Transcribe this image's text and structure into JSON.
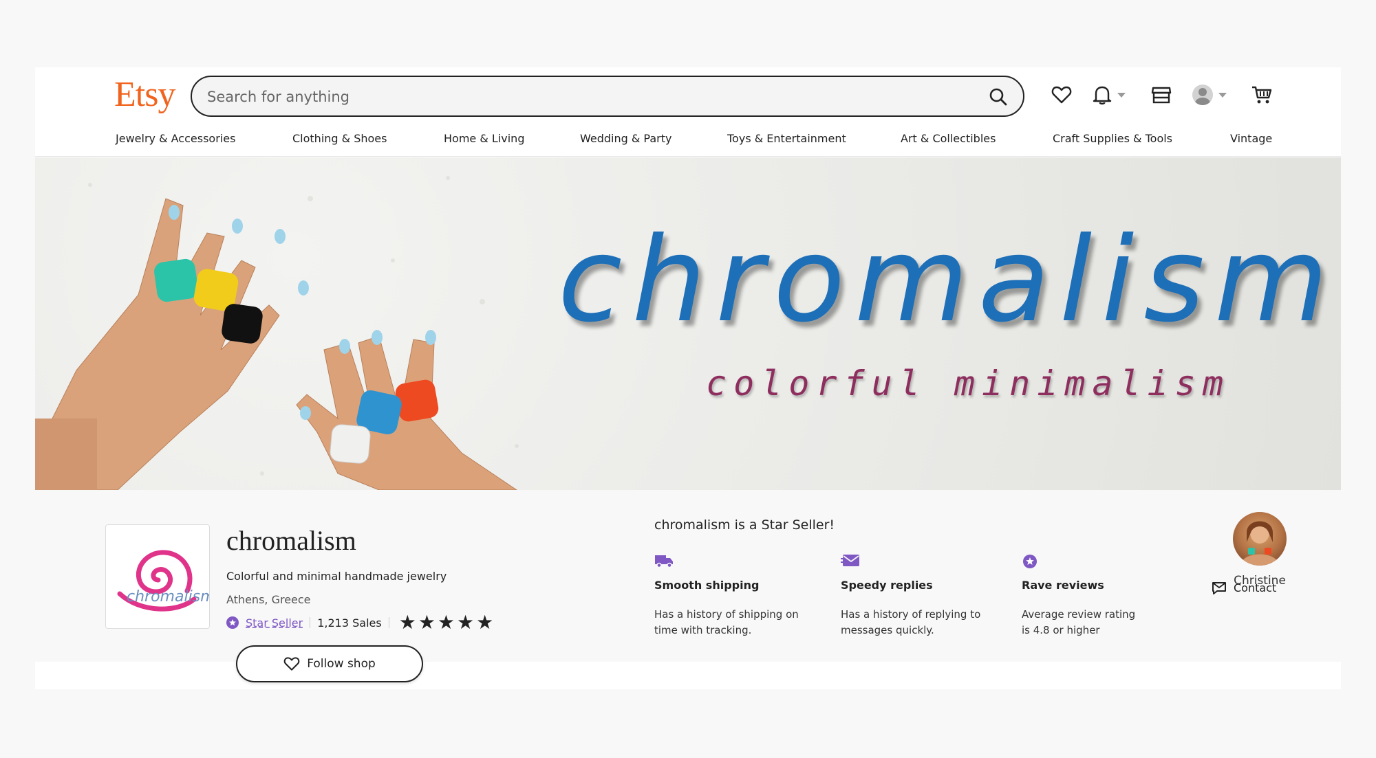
{
  "header": {
    "logo": "Etsy",
    "search_placeholder": "Search for anything"
  },
  "nav": {
    "items": [
      {
        "label": "Jewelry & Accessories"
      },
      {
        "label": "Clothing & Shoes"
      },
      {
        "label": "Home & Living"
      },
      {
        "label": "Wedding & Party"
      },
      {
        "label": "Toys & Entertainment"
      },
      {
        "label": "Art & Collectibles"
      },
      {
        "label": "Craft Supplies & Tools"
      },
      {
        "label": "Vintage"
      }
    ]
  },
  "banner": {
    "title": "chromalism",
    "subtitle": "colorful minimalism"
  },
  "shop": {
    "logo_text": "chromalism",
    "name": "chromalism",
    "tagline": "Colorful and minimal handmade jewelry",
    "location": "Athens, Greece",
    "badge_label": "Star Seller",
    "sales": "1,213 Sales",
    "rating_stars": 5,
    "follow_label": "Follow shop"
  },
  "star_seller": {
    "title": "chromalism is a Star Seller!",
    "features": [
      {
        "icon": "truck-icon",
        "title": "Smooth shipping",
        "desc_line1": "Has a history of shipping on",
        "desc_line2": "time with tracking."
      },
      {
        "icon": "envelope-icon",
        "title": "Speedy replies",
        "desc_line1": "Has a history of replying to",
        "desc_line2": "messages quickly."
      },
      {
        "icon": "star-badge-icon",
        "title": "Rave reviews",
        "desc_line1": "Average review rating",
        "desc_line2": "is 4.8 or higher"
      }
    ]
  },
  "owner": {
    "name": "Christine",
    "contact_label": "Contact"
  },
  "colors": {
    "brand": "#f1641e",
    "star_seller": "#7f58c4",
    "banner_title": "#1d6fb8",
    "banner_subtitle": "#8e2e5e"
  }
}
